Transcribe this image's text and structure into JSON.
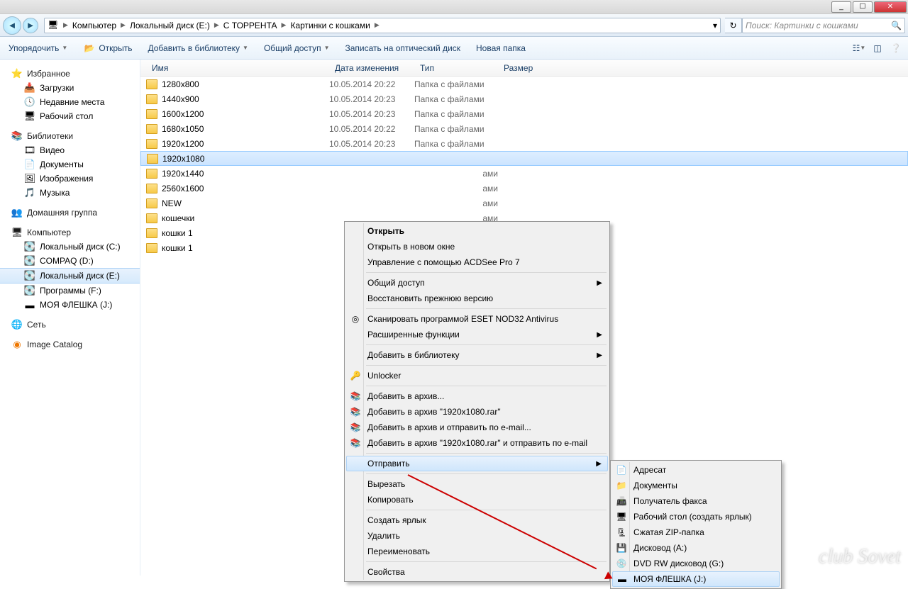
{
  "window": {
    "min": "_",
    "max": "☐",
    "close": "✕"
  },
  "breadcrumb": [
    "Компьютер",
    "Локальный диск (E:)",
    "С ТОРРЕНТА",
    "Картинки с кошками"
  ],
  "search_placeholder": "Поиск: Картинки с кошками",
  "toolbar": {
    "organize": "Упорядочить",
    "open": "Открыть",
    "add_library": "Добавить в библиотеку",
    "share": "Общий доступ",
    "burn": "Записать на оптический диск",
    "new_folder": "Новая папка"
  },
  "sidebar": {
    "favorites": {
      "title": "Избранное",
      "items": [
        "Загрузки",
        "Недавние места",
        "Рабочий стол"
      ]
    },
    "libraries": {
      "title": "Библиотеки",
      "items": [
        "Видео",
        "Документы",
        "Изображения",
        "Музыка"
      ]
    },
    "homegroup": {
      "title": "Домашняя группа"
    },
    "computer": {
      "title": "Компьютер",
      "items": [
        "Локальный диск (C:)",
        "COMPAQ (D:)",
        "Локальный диск (E:)",
        "Программы  (F:)",
        "МОЯ ФЛЕШКА (J:)"
      ],
      "selected_index": 2
    },
    "network": {
      "title": "Сеть"
    },
    "image_catalog": {
      "title": "Image Catalog"
    }
  },
  "columns": {
    "name": "Имя",
    "date": "Дата изменения",
    "type": "Тип",
    "size": "Размер"
  },
  "type_folder": "Папка с файлами",
  "rows": [
    {
      "name": "1280x800",
      "date": "10.05.2014 20:22"
    },
    {
      "name": "1440x900",
      "date": "10.05.2014 20:23"
    },
    {
      "name": "1600x1200",
      "date": "10.05.2014 20:23"
    },
    {
      "name": "1680x1050",
      "date": "10.05.2014 20:22"
    },
    {
      "name": "1920x1200",
      "date": "10.05.2014 20:23"
    },
    {
      "name": "1920x1080",
      "date": "",
      "selected": true
    },
    {
      "name": "1920x1440",
      "date": ""
    },
    {
      "name": "2560x1600",
      "date": ""
    },
    {
      "name": "NEW",
      "date": ""
    },
    {
      "name": "кошечки",
      "date": ""
    },
    {
      "name": "кошки 1",
      "date": ""
    },
    {
      "name": "кошки 1",
      "date": ""
    }
  ],
  "ctx1": {
    "items": [
      {
        "label": "Открыть",
        "bold": true
      },
      {
        "label": "Открыть в новом окне"
      },
      {
        "label": "Управление с помощью ACDSee Pro 7"
      },
      {
        "sep": true
      },
      {
        "label": "Общий доступ",
        "arrow": true
      },
      {
        "label": "Восстановить прежнюю версию"
      },
      {
        "sep": true
      },
      {
        "label": "Сканировать программой ESET NOD32 Antivirus",
        "icon": "◎"
      },
      {
        "label": "Расширенные функции",
        "arrow": true
      },
      {
        "sep": true
      },
      {
        "label": "Добавить в библиотеку",
        "arrow": true
      },
      {
        "sep": true
      },
      {
        "label": "Unlocker",
        "icon": "🔑"
      },
      {
        "sep": true
      },
      {
        "label": "Добавить в архив...",
        "icon": "📚"
      },
      {
        "label": "Добавить в архив \"1920x1080.rar\"",
        "icon": "📚"
      },
      {
        "label": "Добавить в архив и отправить по e-mail...",
        "icon": "📚"
      },
      {
        "label": "Добавить в архив \"1920x1080.rar\" и отправить по e-mail",
        "icon": "📚"
      },
      {
        "sep": true
      },
      {
        "label": "Отправить",
        "arrow": true,
        "hover": true
      },
      {
        "sep": true
      },
      {
        "label": "Вырезать"
      },
      {
        "label": "Копировать"
      },
      {
        "sep": true
      },
      {
        "label": "Создать ярлык"
      },
      {
        "label": "Удалить"
      },
      {
        "label": "Переименовать"
      },
      {
        "sep": true
      },
      {
        "label": "Свойства"
      }
    ]
  },
  "ctx2": {
    "items": [
      {
        "label": "Адресат",
        "icon": "📄"
      },
      {
        "label": "Документы",
        "icon": "📁"
      },
      {
        "label": "Получатель факса",
        "icon": "📠"
      },
      {
        "label": "Рабочий стол (создать ярлык)",
        "icon": "🖥"
      },
      {
        "label": "Сжатая ZIP-папка",
        "icon": "🗜"
      },
      {
        "label": "Дисковод (A:)",
        "icon": "💾"
      },
      {
        "label": "DVD RW дисковод (G:)",
        "icon": "💿"
      },
      {
        "label": "МОЯ ФЛЕШКА (J:)",
        "icon": "▬",
        "hover": true
      }
    ]
  },
  "watermark": "club Sovet"
}
